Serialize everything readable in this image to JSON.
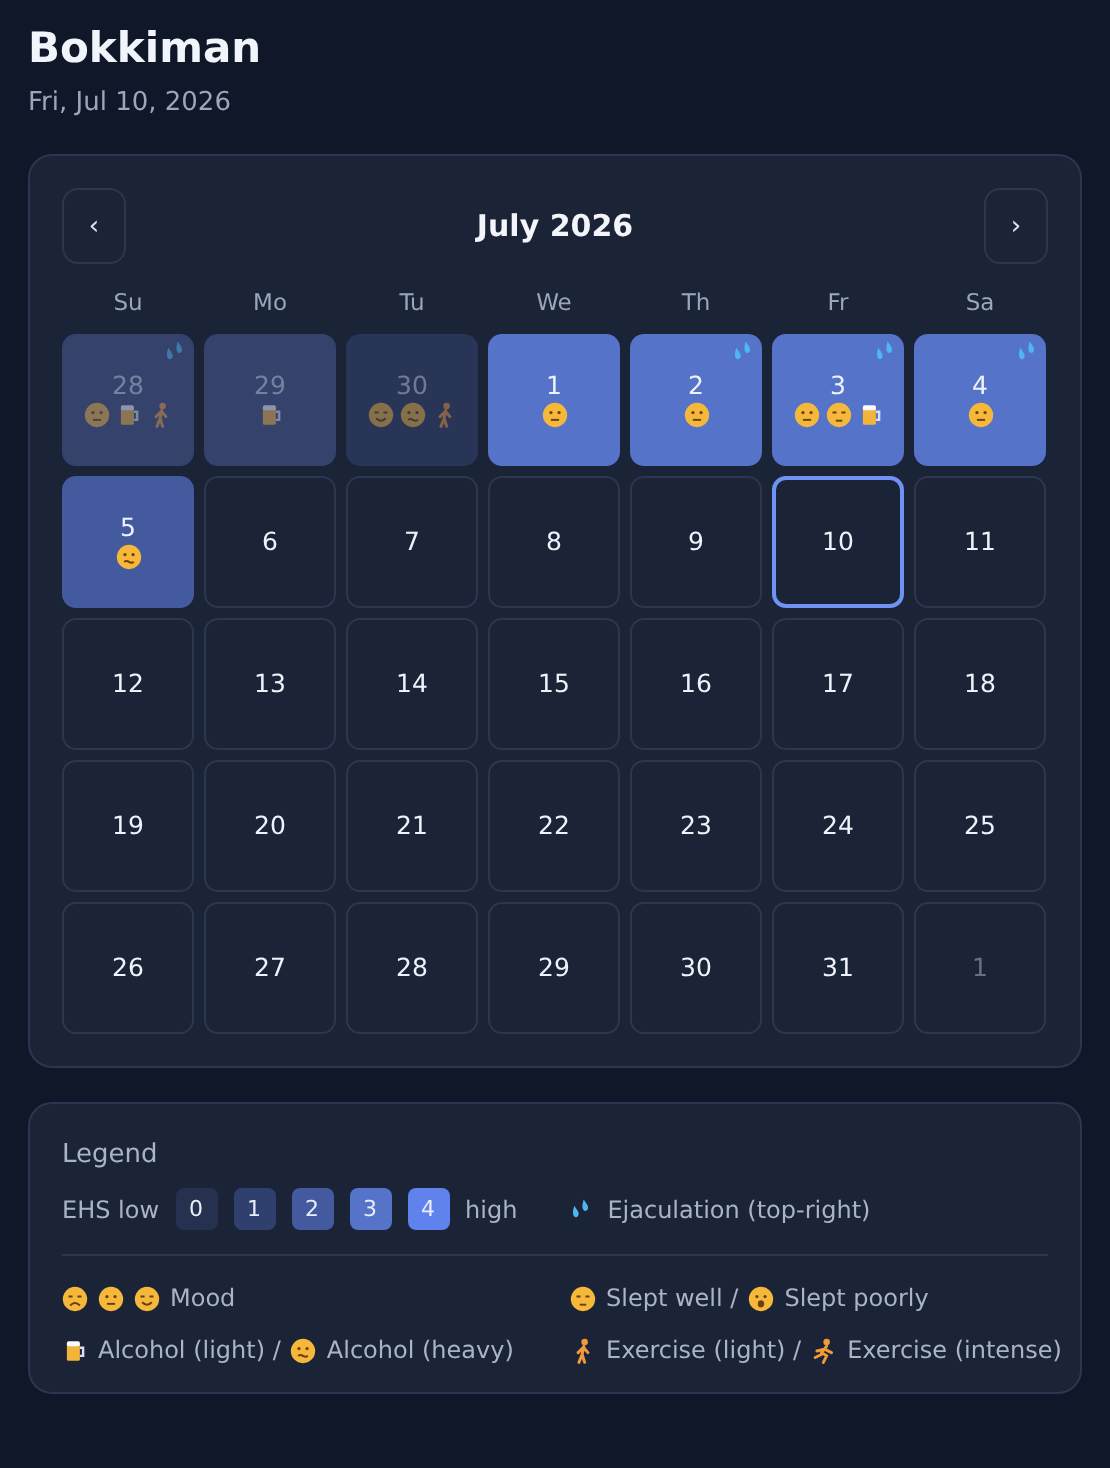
{
  "header": {
    "title": "Bokkiman",
    "date": "Fri, Jul 10, 2026"
  },
  "calendar": {
    "month": "July 2026",
    "prev": "‹",
    "next": "›",
    "weekdays": [
      "Su",
      "Mo",
      "Tu",
      "We",
      "Th",
      "Fr",
      "Sa"
    ],
    "days": [
      {
        "day": "28",
        "outside": true,
        "color": "#34426c",
        "drops": true,
        "today": false,
        "icons": [
          {
            "kind": "neutral"
          },
          {
            "kind": "beer"
          },
          {
            "kind": "walk"
          }
        ]
      },
      {
        "day": "29",
        "outside": true,
        "color": "#34426c",
        "drops": false,
        "today": false,
        "icons": [
          {
            "kind": "beer"
          }
        ]
      },
      {
        "day": "30",
        "outside": true,
        "color": "#293556",
        "drops": false,
        "today": false,
        "icons": [
          {
            "kind": "happy"
          },
          {
            "kind": "woozy"
          },
          {
            "kind": "walk"
          }
        ]
      },
      {
        "day": "1",
        "outside": false,
        "color": "#5573c9",
        "drops": false,
        "today": false,
        "icons": [
          {
            "kind": "neutral"
          }
        ]
      },
      {
        "day": "2",
        "outside": false,
        "color": "#5573c9",
        "drops": true,
        "today": false,
        "icons": [
          {
            "kind": "neutral"
          }
        ]
      },
      {
        "day": "3",
        "outside": false,
        "color": "#5573c9",
        "drops": true,
        "today": false,
        "icons": [
          {
            "kind": "neutral"
          },
          {
            "kind": "sleepy"
          },
          {
            "kind": "beer"
          }
        ]
      },
      {
        "day": "4",
        "outside": false,
        "color": "#5573c9",
        "drops": true,
        "today": false,
        "icons": [
          {
            "kind": "neutral"
          }
        ]
      },
      {
        "day": "5",
        "outside": false,
        "color": "#445a9e",
        "drops": false,
        "today": false,
        "icons": [
          {
            "kind": "woozy"
          }
        ]
      },
      {
        "day": "6",
        "outside": false,
        "drops": false,
        "today": false
      },
      {
        "day": "7",
        "outside": false,
        "drops": false,
        "today": false
      },
      {
        "day": "8",
        "outside": false,
        "drops": false,
        "today": false
      },
      {
        "day": "9",
        "outside": false,
        "drops": false,
        "today": false
      },
      {
        "day": "10",
        "outside": false,
        "drops": false,
        "today": true
      },
      {
        "day": "11",
        "outside": false,
        "drops": false,
        "today": false
      },
      {
        "day": "12",
        "outside": false,
        "drops": false,
        "today": false
      },
      {
        "day": "13",
        "outside": false,
        "drops": false,
        "today": false
      },
      {
        "day": "14",
        "outside": false,
        "drops": false,
        "today": false
      },
      {
        "day": "15",
        "outside": false,
        "drops": false,
        "today": false
      },
      {
        "day": "16",
        "outside": false,
        "drops": false,
        "today": false
      },
      {
        "day": "17",
        "outside": false,
        "drops": false,
        "today": false
      },
      {
        "day": "18",
        "outside": false,
        "drops": false,
        "today": false
      },
      {
        "day": "19",
        "outside": false,
        "drops": false,
        "today": false
      },
      {
        "day": "20",
        "outside": false,
        "drops": false,
        "today": false
      },
      {
        "day": "21",
        "outside": false,
        "drops": false,
        "today": false
      },
      {
        "day": "22",
        "outside": false,
        "drops": false,
        "today": false
      },
      {
        "day": "23",
        "outside": false,
        "drops": false,
        "today": false
      },
      {
        "day": "24",
        "outside": false,
        "drops": false,
        "today": false
      },
      {
        "day": "25",
        "outside": false,
        "drops": false,
        "today": false
      },
      {
        "day": "26",
        "outside": false,
        "drops": false,
        "today": false
      },
      {
        "day": "27",
        "outside": false,
        "drops": false,
        "today": false
      },
      {
        "day": "28",
        "outside": false,
        "drops": false,
        "today": false
      },
      {
        "day": "29",
        "outside": false,
        "drops": false,
        "today": false
      },
      {
        "day": "30",
        "outside": false,
        "drops": false,
        "today": false
      },
      {
        "day": "31",
        "outside": false,
        "drops": false,
        "today": false
      },
      {
        "day": "1",
        "outside": true,
        "drops": false,
        "today": false
      }
    ]
  },
  "legend": {
    "title": "Legend",
    "low": "EHS low",
    "high": "high",
    "scale": [
      {
        "label": "0",
        "color": "#25314f"
      },
      {
        "label": "1",
        "color": "#2f3f6e"
      },
      {
        "label": "2",
        "color": "#445a9e"
      },
      {
        "label": "3",
        "color": "#5573c9"
      },
      {
        "label": "4",
        "color": "#5f82ec"
      }
    ],
    "drops_label": "Ejaculation (top-right)",
    "items": [
      {
        "parts": [
          {
            "kind": "sad"
          },
          {
            "kind": "neutral"
          },
          {
            "kind": "happy"
          },
          {
            "kind": "text",
            "text": "Mood"
          }
        ]
      },
      {
        "parts": [
          {
            "kind": "sleepy"
          },
          {
            "kind": "text",
            "text": "Slept well /"
          },
          {
            "kind": "yawn"
          },
          {
            "kind": "text",
            "text": "Slept poorly"
          }
        ]
      },
      {
        "parts": [
          {
            "kind": "beer"
          },
          {
            "kind": "text",
            "text": "Alcohol (light) /"
          },
          {
            "kind": "woozy"
          },
          {
            "kind": "text",
            "text": "Alcohol (heavy)"
          }
        ]
      },
      {
        "parts": [
          {
            "kind": "walk"
          },
          {
            "kind": "text",
            "text": "Exercise (light) /"
          },
          {
            "kind": "run"
          },
          {
            "kind": "text",
            "text": "Exercise (intense)"
          }
        ]
      }
    ]
  }
}
